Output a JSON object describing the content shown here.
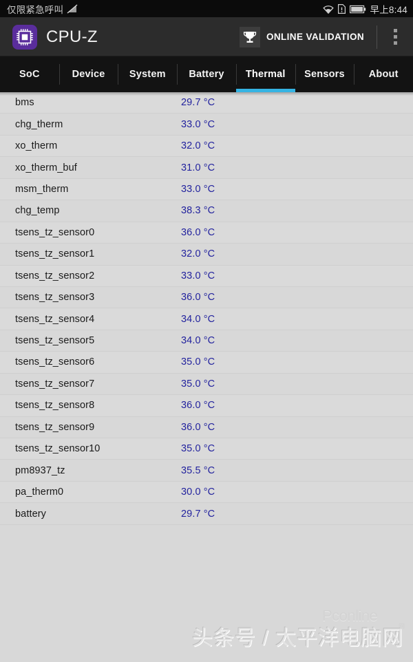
{
  "status_bar": {
    "carrier_text": "仅限紧急呼叫",
    "time": "早上8:44",
    "icons": [
      "signal-off-icon",
      "wifi-icon",
      "sim-alert-icon",
      "battery-icon"
    ],
    "background_color": "#0b0b0b"
  },
  "app_bar": {
    "app_icon": "cpu-chip-icon",
    "title": "CPU-Z",
    "brand_color": "#5a2d9c",
    "validation": {
      "icon": "trophy-icon",
      "label": "ONLINE VALIDATION"
    },
    "overflow_menu": "more-vertical-icon",
    "background_color": "#2c2c2c"
  },
  "tabs": {
    "active_index": 4,
    "accent_color": "#35b4e3",
    "items": [
      {
        "label": "SoC"
      },
      {
        "label": "Device"
      },
      {
        "label": "System"
      },
      {
        "label": "Battery"
      },
      {
        "label": "Thermal"
      },
      {
        "label": "Sensors"
      },
      {
        "label": "About"
      }
    ]
  },
  "thermal_list": {
    "label_color": "#1a1a1a",
    "value_color": "#23239e",
    "row_background": "#d9d9d9",
    "rows": [
      {
        "label": "bms",
        "value": "29.7 °C"
      },
      {
        "label": "chg_therm",
        "value": "33.0 °C"
      },
      {
        "label": "xo_therm",
        "value": "32.0 °C"
      },
      {
        "label": "xo_therm_buf",
        "value": "31.0 °C"
      },
      {
        "label": "msm_therm",
        "value": "33.0 °C"
      },
      {
        "label": "chg_temp",
        "value": "38.3 °C"
      },
      {
        "label": "tsens_tz_sensor0",
        "value": "36.0 °C"
      },
      {
        "label": "tsens_tz_sensor1",
        "value": "32.0 °C"
      },
      {
        "label": "tsens_tz_sensor2",
        "value": "33.0 °C"
      },
      {
        "label": "tsens_tz_sensor3",
        "value": "36.0 °C"
      },
      {
        "label": "tsens_tz_sensor4",
        "value": "34.0 °C"
      },
      {
        "label": "tsens_tz_sensor5",
        "value": "34.0 °C"
      },
      {
        "label": "tsens_tz_sensor6",
        "value": "35.0 °C"
      },
      {
        "label": "tsens_tz_sensor7",
        "value": "35.0 °C"
      },
      {
        "label": "tsens_tz_sensor8",
        "value": "36.0 °C"
      },
      {
        "label": "tsens_tz_sensor9",
        "value": "36.0 °C"
      },
      {
        "label": "tsens_tz_sensor10",
        "value": "35.0 °C"
      },
      {
        "label": "pm8937_tz",
        "value": "35.5 °C"
      },
      {
        "label": "pa_therm0",
        "value": "30.0 °C"
      },
      {
        "label": "battery",
        "value": "29.7 °C"
      }
    ]
  },
  "watermarks": {
    "logo_text": "Pconline",
    "logo_suffix": "网",
    "caption": "头条号 / 太平洋电脑网"
  }
}
